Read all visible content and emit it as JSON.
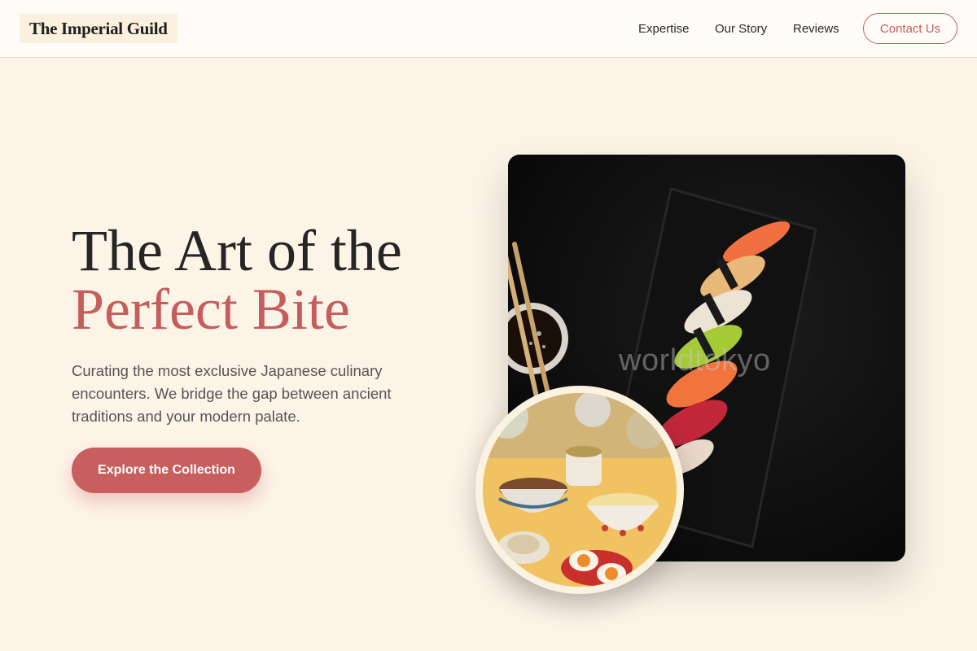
{
  "brand": {
    "logo_text": "The Imperial Guild"
  },
  "nav": {
    "items": [
      {
        "label": "Expertise"
      },
      {
        "label": "Our Story"
      },
      {
        "label": "Reviews"
      }
    ],
    "contact_label": "Contact Us"
  },
  "hero": {
    "title_line1": "The Art of the",
    "title_line2": "Perfect Bite",
    "subtitle": "Curating the most exclusive Japanese culinary encounters. We bridge the gap between ancient traditions and your modern palate.",
    "cta_label": "Explore the Collection"
  },
  "images": {
    "main_photo": {
      "subject": "sushi nigiri on black slate plate",
      "watermark": "worldtokyo"
    },
    "secondary_photo": {
      "subject": "Japanese meal spread with rice bowls and soft-boiled eggs"
    }
  },
  "colors": {
    "accent": "#c65d5d",
    "background": "#fdf4e8",
    "header_bg": "#fffcf7",
    "text_dark": "#252525"
  }
}
